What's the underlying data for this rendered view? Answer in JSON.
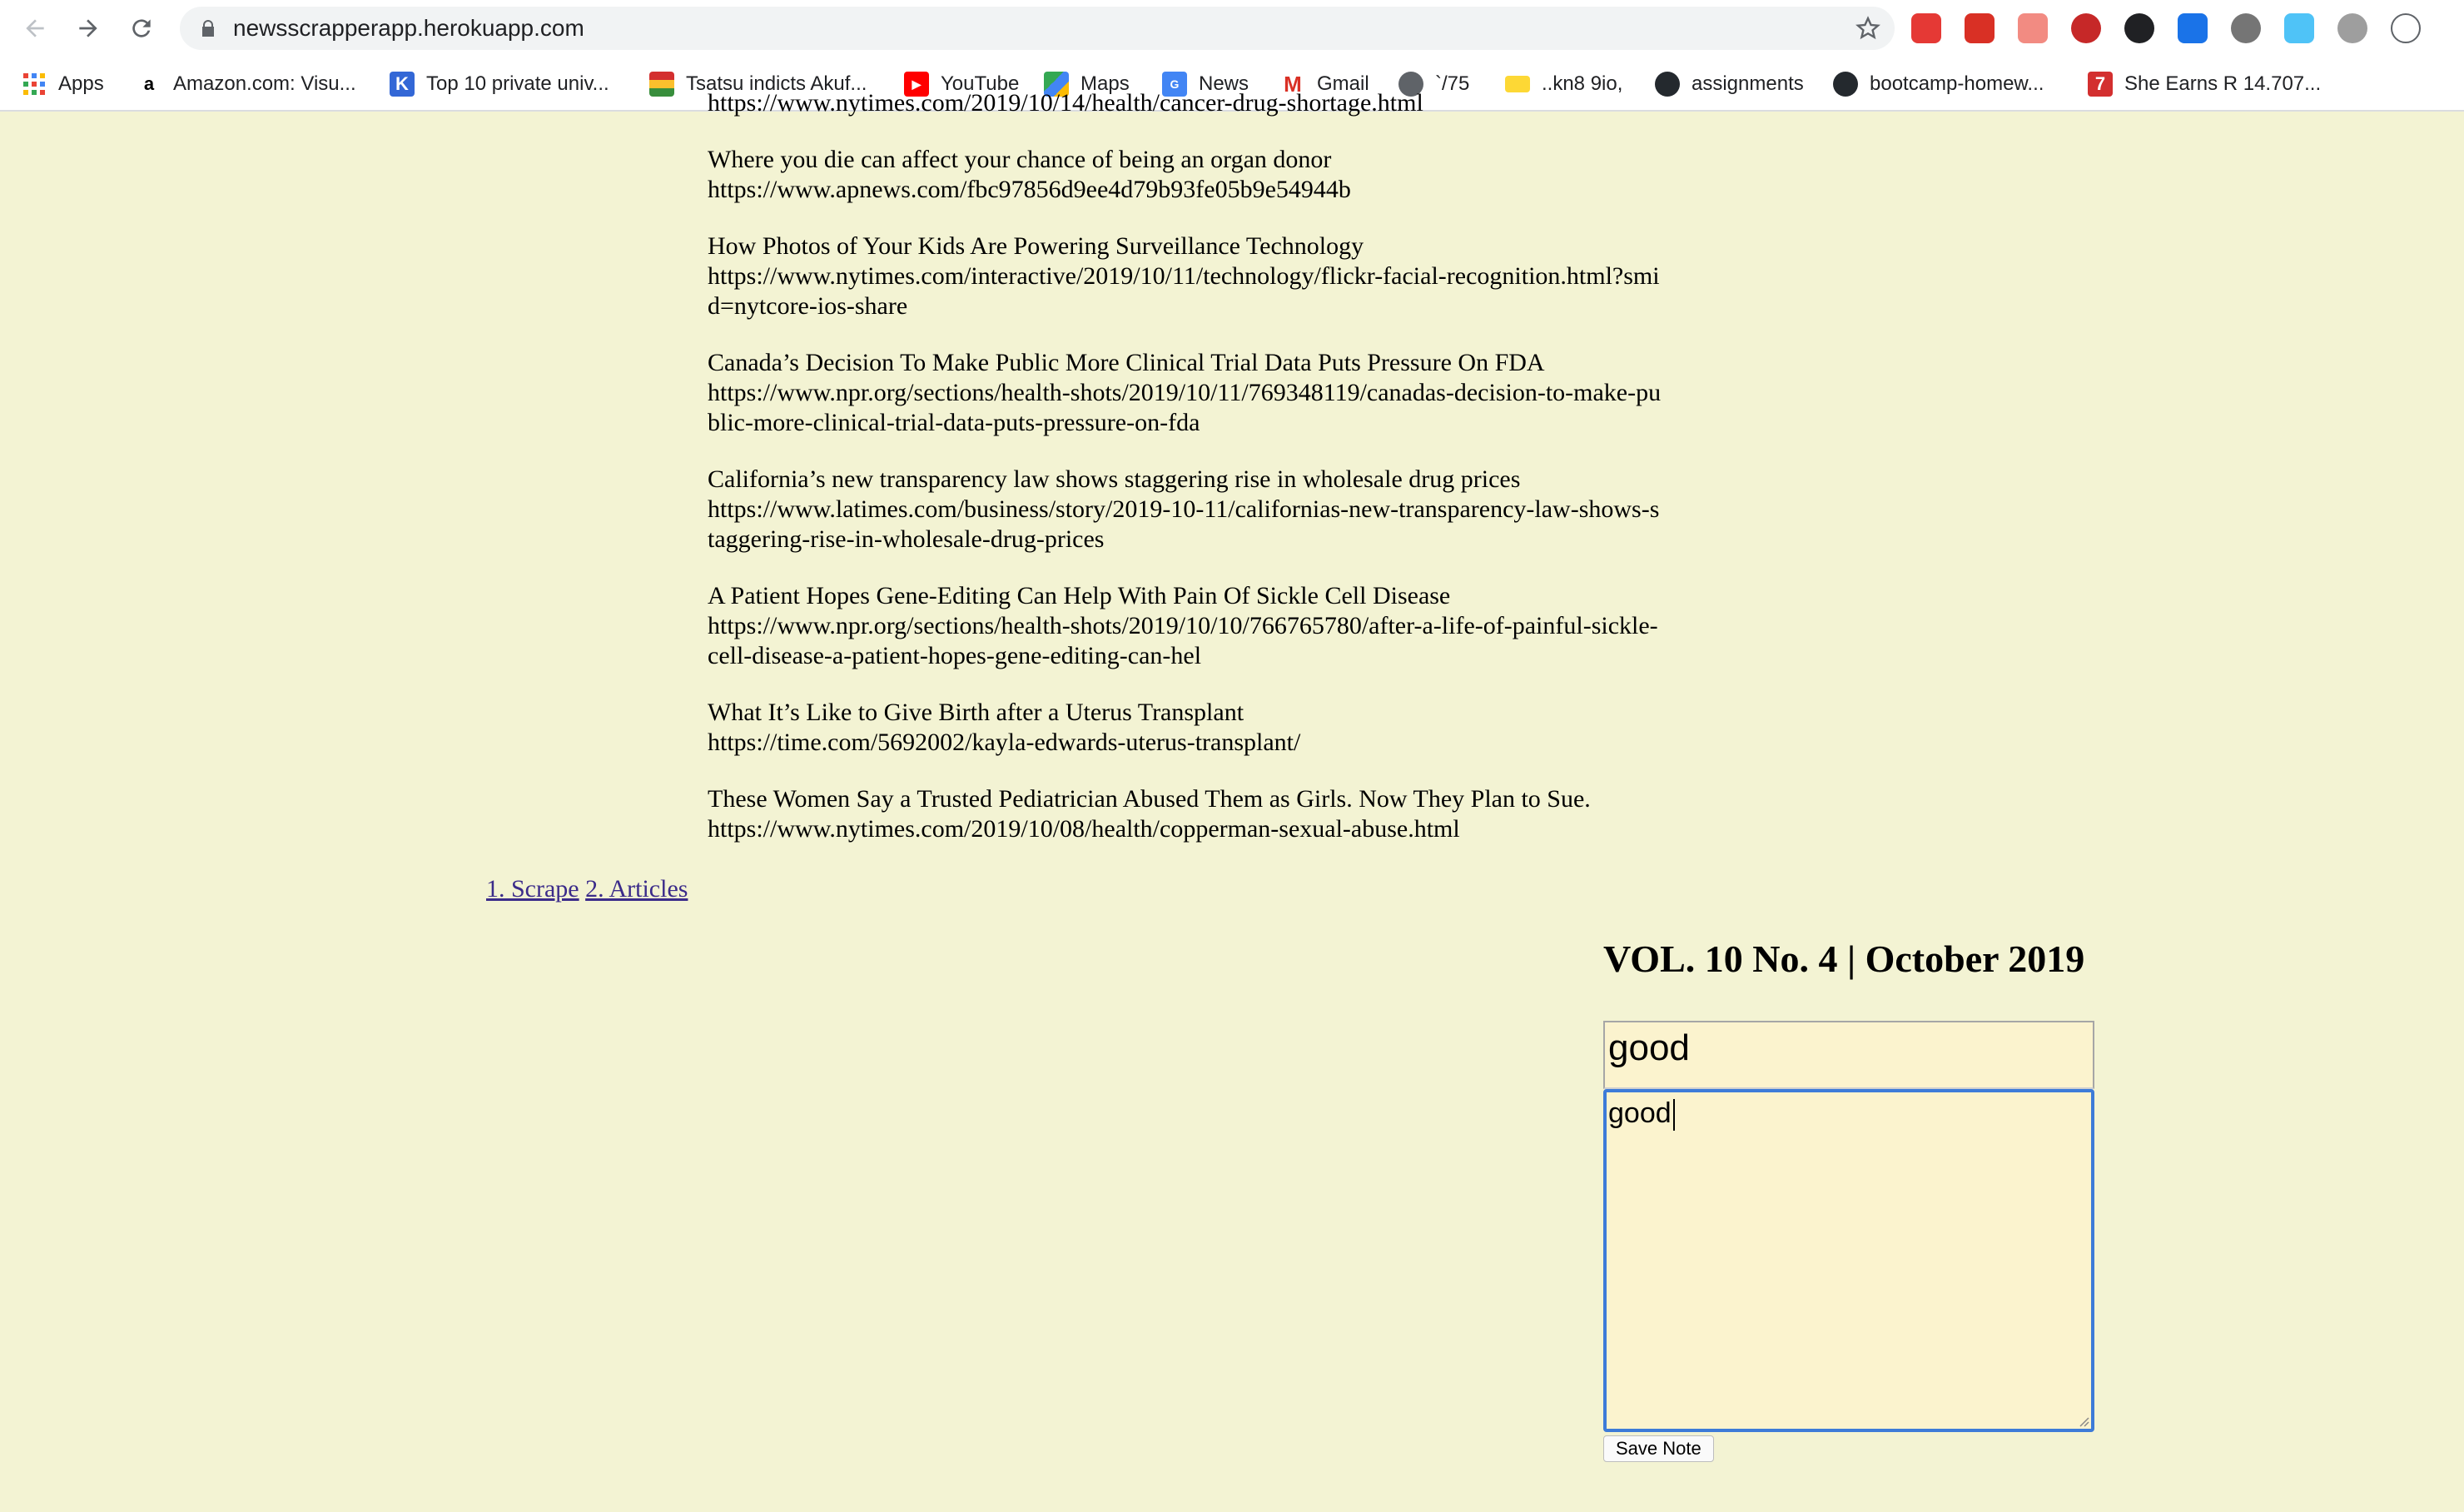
{
  "browser": {
    "url": "newsscrapperapp.herokuapp.com",
    "bookmarks": [
      {
        "label": "Apps",
        "icon": "apps-grid-icon"
      },
      {
        "label": "Amazon.com: Visu...",
        "icon": "amazon-icon"
      },
      {
        "label": "Top 10 private univ...",
        "icon": "university-icon"
      },
      {
        "label": "Tsatsu indicts Akuf...",
        "icon": "ghana-flag-icon"
      },
      {
        "label": "YouTube",
        "icon": "youtube-icon"
      },
      {
        "label": "Maps",
        "icon": "maps-icon"
      },
      {
        "label": "News",
        "icon": "news-icon"
      },
      {
        "label": "Gmail",
        "icon": "gmail-icon"
      },
      {
        "label": "`/75",
        "icon": "globe-icon"
      },
      {
        "label": "..kn8 9io,",
        "icon": "tag-icon"
      },
      {
        "label": "assignments",
        "icon": "github-icon"
      },
      {
        "label": "bootcamp-homew...",
        "icon": "github-icon"
      },
      {
        "label": "She Earns R 14.707...",
        "icon": "seven-icon"
      }
    ]
  },
  "articles": [
    {
      "title": "",
      "link": "https://www.nytimes.com/2019/10/14/health/cancer-drug-shortage.html"
    },
    {
      "title": "Where you die can affect your chance of being an organ donor",
      "link": "https://www.apnews.com/fbc97856d9ee4d79b93fe05b9e54944b"
    },
    {
      "title": "How Photos of Your Kids Are Powering Surveillance Technology",
      "link": "https://www.nytimes.com/interactive/2019/10/11/technology/flickr-facial-recognition.html?smid=nytcore-ios-share"
    },
    {
      "title": "Canada’s Decision To Make Public More Clinical Trial Data Puts Pressure On FDA",
      "link": "https://www.npr.org/sections/health-shots/2019/10/11/769348119/canadas-decision-to-make-public-more-clinical-trial-data-puts-pressure-on-fda"
    },
    {
      "title": "California’s new transparency law shows staggering rise in wholesale drug prices",
      "link": "https://www.latimes.com/business/story/2019-10-11/californias-new-transparency-law-shows-staggering-rise-in-wholesale-drug-prices"
    },
    {
      "title": "A Patient Hopes Gene-Editing Can Help With Pain Of Sickle Cell Disease",
      "link": "https://www.npr.org/sections/health-shots/2019/10/10/766765780/after-a-life-of-painful-sickle-cell-disease-a-patient-hopes-gene-editing-can-hel"
    },
    {
      "title": "What It’s Like to Give Birth after a Uterus Transplant",
      "link": "https://time.com/5692002/kayla-edwards-uterus-transplant/"
    },
    {
      "title": "These Women Say a Trusted Pediatrician Abused Them as Girls. Now They Plan to Sue.",
      "link": "https://www.nytimes.com/2019/10/08/health/copperman-sexual-abuse.html"
    }
  ],
  "pager": {
    "scrape_label": "1. Scrape",
    "articles_label": "2. Articles"
  },
  "note": {
    "volume": "VOL. 10 No. 4 | October 2019",
    "title_value": "good",
    "body_value": "good",
    "save_label": "Save Note"
  },
  "colors": {
    "page_background": "#f3f3d3",
    "input_background": "#fbf3ce",
    "focus_border": "#3d7bd8"
  }
}
